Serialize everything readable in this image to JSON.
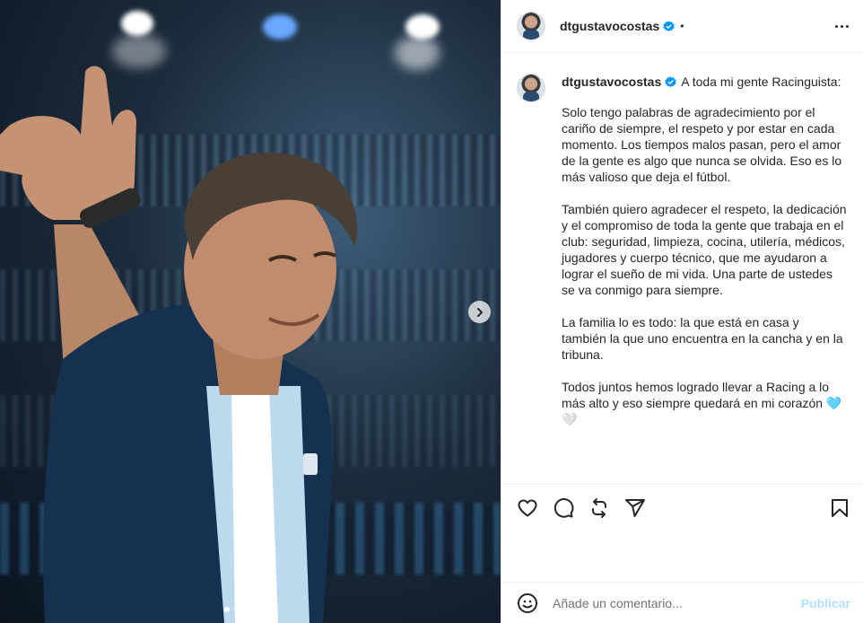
{
  "post": {
    "username": "dtgustavocostas",
    "bullet": "•",
    "caption_intro": "A toda mi gente Racinguista:",
    "paragraphs": [
      "Solo tengo palabras de agradecimiento por el cariño de siempre, el respeto y por estar en cada momento. Los tiempos malos pasan, pero el amor de la gente es algo que nunca se olvida. Eso es lo más valioso que deja el fútbol.",
      "También quiero agradecer el respeto, la dedicación y el compromiso de toda la gente que trabaja en el club: seguridad, limpieza, cocina, utilería, médicos, jugadores y cuerpo técnico, que me ayudaron a lograr el sueño de mi vida. Una parte de ustedes se va conmigo para siempre.",
      "La familia lo es todo: la que está en casa y también la que uno encuentra en la cancha y en la tribuna.",
      "Todos juntos hemos logrado llevar a Racing a lo más alto y eso siempre quedará en mi corazón 🩵🤍"
    ]
  },
  "carousel": {
    "slide_count": 5,
    "active_index": 0
  },
  "comment": {
    "placeholder": "Añade un comentario...",
    "publish_label": "Publicar"
  },
  "icons": {
    "verified": "verified-badge-icon",
    "more": "more-options-icon",
    "like": "heart-icon",
    "comment": "comment-icon",
    "share": "repost-icon",
    "send": "send-icon",
    "save": "bookmark-icon",
    "emoji": "emoji-icon",
    "next": "chevron-right-icon"
  },
  "colors": {
    "verified": "#0095f6",
    "publish": "#b2dffc",
    "text": "#262626",
    "placeholder": "#737373"
  }
}
